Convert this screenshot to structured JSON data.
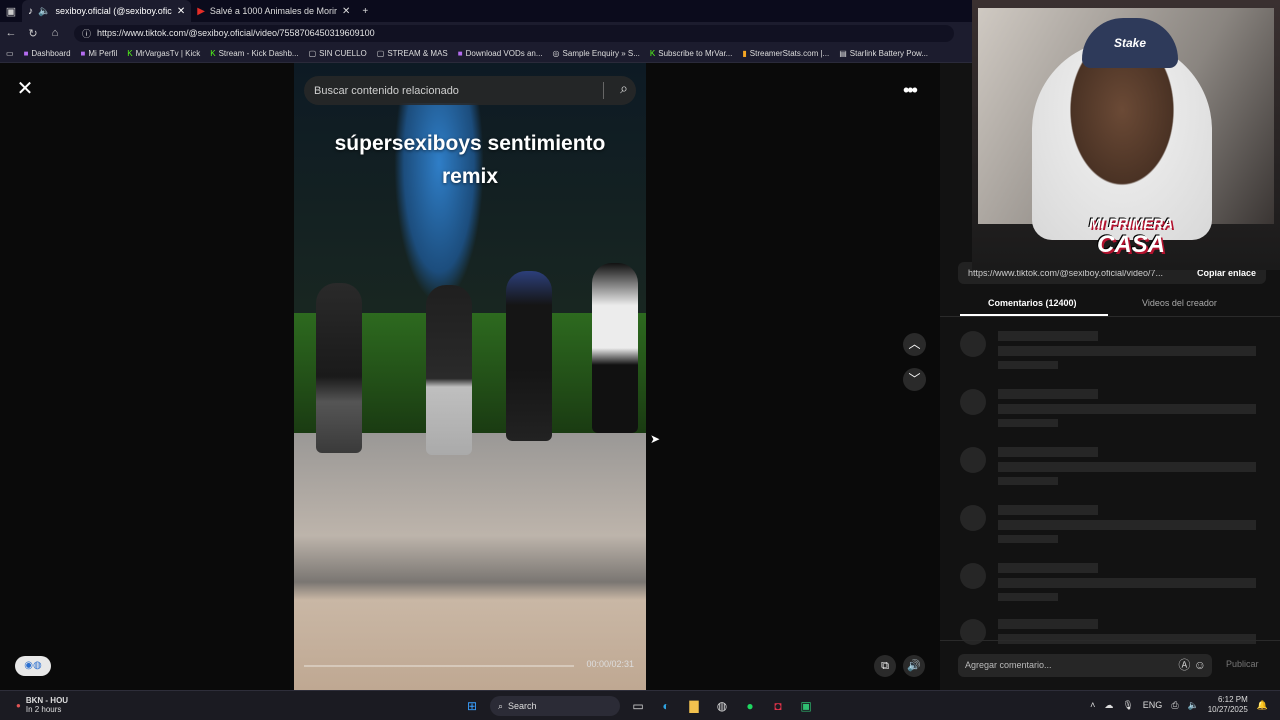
{
  "browser": {
    "tabs": [
      {
        "label": "sexiboy.oficial (@sexiboy.ofic",
        "icon": "tiktok-icon"
      },
      {
        "label": "Salvé a 1000 Animales de Morir",
        "icon": "youtube-icon"
      }
    ],
    "url": "https://www.tiktok.com/@sexiboy.oficial/video/7558706450319609100",
    "bookmarks": [
      "Dashboard",
      "Mi Perfil",
      "MrVargasTv | Kick",
      "Stream - Kick Dashb...",
      "SIN CUELLO",
      "STREAM & MAS",
      "Download VODs an...",
      "Sample Enquiry » S...",
      "Subscribe to MrVar...",
      "StreamerStats.com |...",
      "Starlink Battery Pow..."
    ]
  },
  "video": {
    "search_placeholder": "Buscar contenido relacionado",
    "caption_line1": "súpersexiboys  sentimiento",
    "caption_line2": "remix",
    "time": "00:00/02:31"
  },
  "panel": {
    "link": "https://www.tiktok.com/@sexiboy.oficial/video/7...",
    "copy_label": "Copiar enlace",
    "tab_comments": "Comentarios (12400)",
    "tab_creator": "Videos del creador",
    "comment_placeholder": "Agregar comentario...",
    "publish_label": "Publicar"
  },
  "webcam": {
    "hat_text": "Stake",
    "logo_line1": "MI PRIMERA",
    "logo_line2": "CASA"
  },
  "taskbar": {
    "weather_title": "BKN - HOU",
    "weather_sub": "In 2 hours",
    "search_label": "Search",
    "lang": "ENG",
    "time": "6:12 PM",
    "date": "10/27/2025"
  }
}
